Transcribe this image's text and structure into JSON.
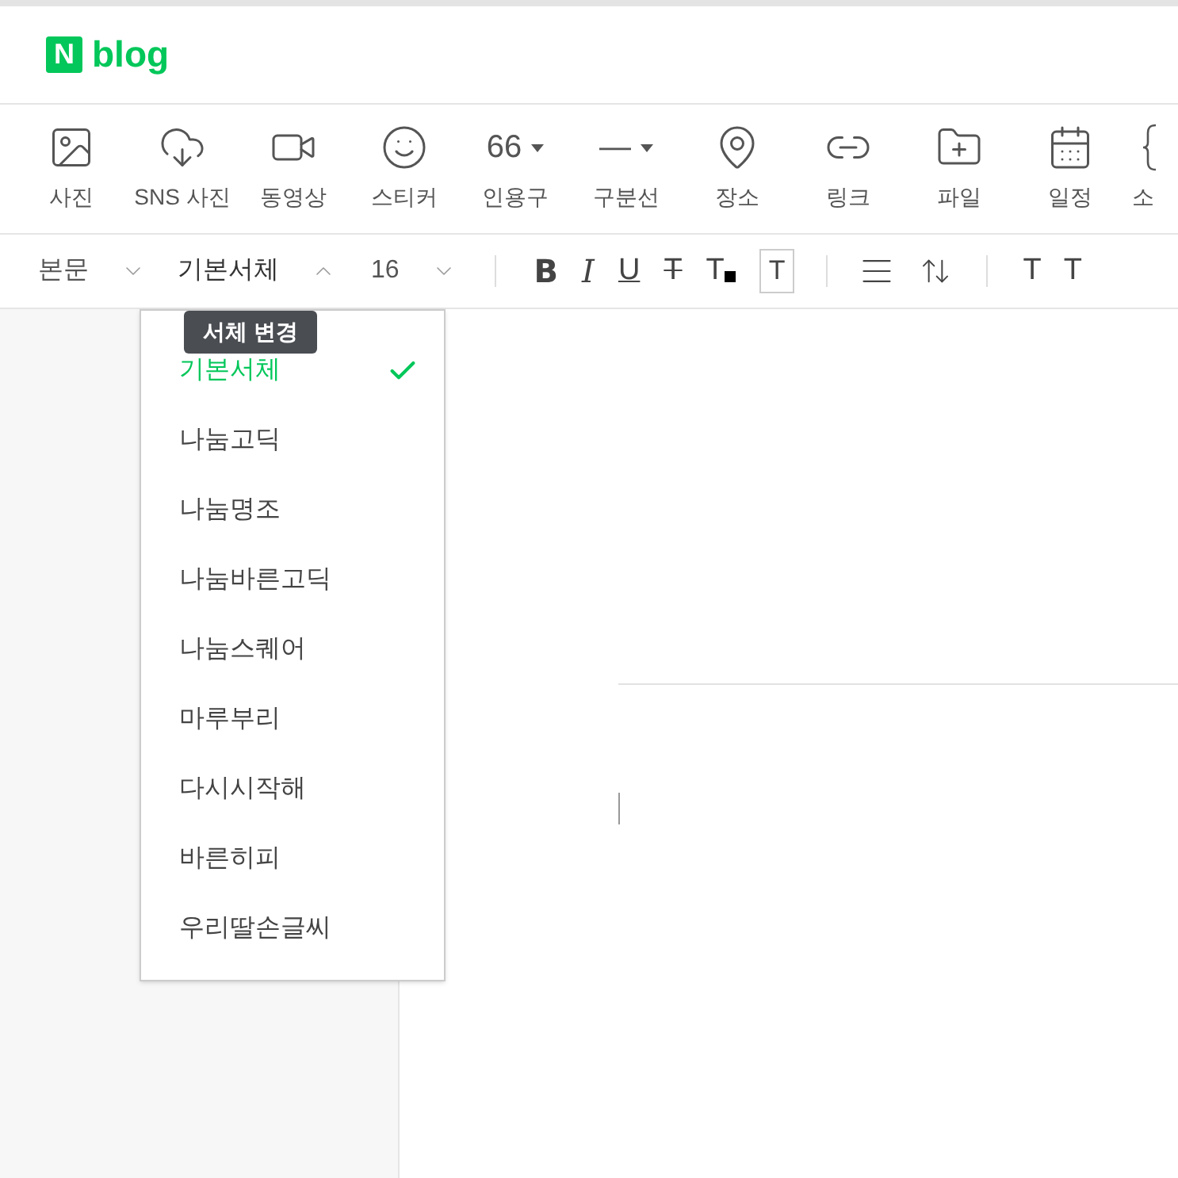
{
  "logo": {
    "mark": "N",
    "text": "blog"
  },
  "toolbar": [
    {
      "kind": "image",
      "label": "사진"
    },
    {
      "kind": "cloud",
      "label": "SNS 사진"
    },
    {
      "kind": "video",
      "label": "동영상"
    },
    {
      "kind": "smile",
      "label": "스티커"
    },
    {
      "kind": "glyph",
      "glyph": "66",
      "label": "인용구"
    },
    {
      "kind": "glyph",
      "glyph": "—",
      "label": "구분선"
    },
    {
      "kind": "pin",
      "label": "장소"
    },
    {
      "kind": "link",
      "label": "링크"
    },
    {
      "kind": "folder",
      "label": "파일"
    },
    {
      "kind": "calendar",
      "label": "일정"
    },
    {
      "kind": "braces",
      "label": "소"
    }
  ],
  "format_bar": {
    "style": "본문",
    "font": "기본서체",
    "font_open": true,
    "size": "16",
    "buttons": [
      {
        "kind": "bold",
        "label": "B"
      },
      {
        "kind": "italic",
        "label": "I"
      },
      {
        "kind": "underline",
        "label": "U"
      },
      {
        "kind": "strike",
        "label": "T"
      },
      {
        "kind": "color",
        "label": "T"
      },
      {
        "kind": "boxed",
        "label": "T"
      }
    ],
    "tail": [
      "T",
      "T"
    ]
  },
  "font_menu": {
    "tooltip": "서체 변경",
    "items": [
      {
        "label": "기본서체",
        "selected": true
      },
      {
        "label": "나눔고딕",
        "selected": false
      },
      {
        "label": "나눔명조",
        "selected": false
      },
      {
        "label": "나눔바른고딕",
        "selected": false
      },
      {
        "label": "나눔스퀘어",
        "selected": false
      },
      {
        "label": "마루부리",
        "selected": false
      },
      {
        "label": "다시시작해",
        "selected": false
      },
      {
        "label": "바른히피",
        "selected": false
      },
      {
        "label": "우리딸손글씨",
        "selected": false
      }
    ]
  }
}
